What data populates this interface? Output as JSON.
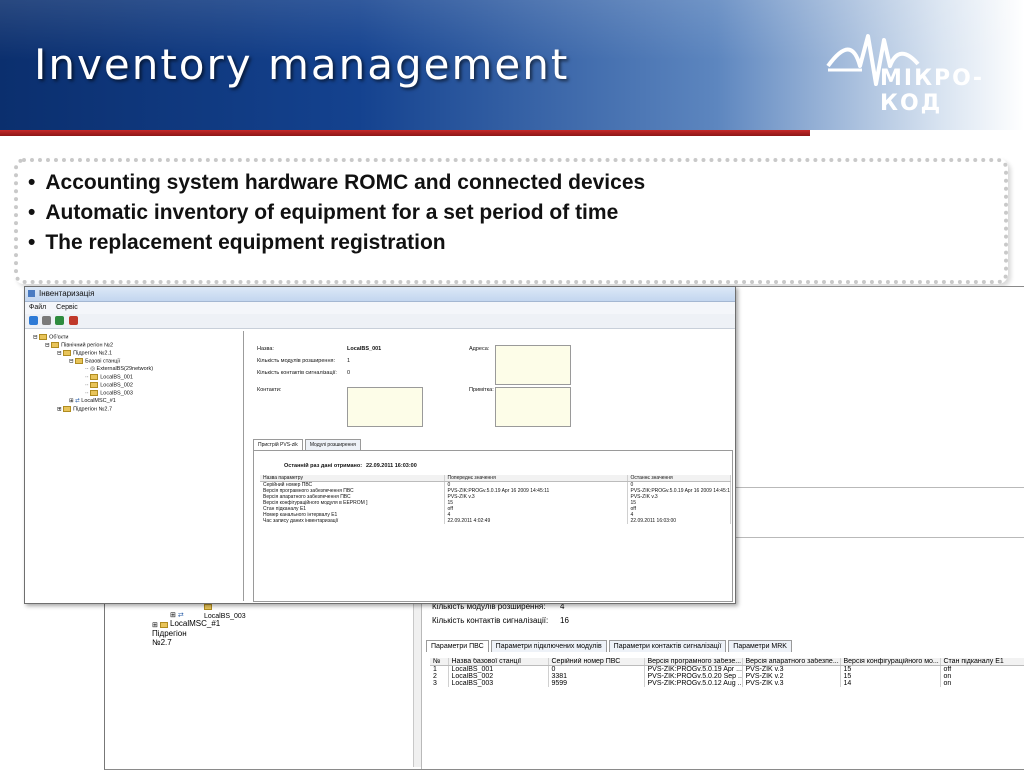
{
  "slide": {
    "title": "Inventory management",
    "logo_text": "МІКРО-КОД",
    "bullets": [
      "Accounting system hardware ROMC and connected devices",
      "Automatic inventory of equipment for a set period of time",
      "The replacement equipment registration"
    ]
  },
  "colors": {
    "header_dark": "#0b2f6e",
    "accent_red": "#c62a2a",
    "field_bg": "#fdfde8"
  },
  "front_window": {
    "title": "Інвентаризація",
    "menu": [
      "Файл",
      "Сервіс"
    ],
    "tree": [
      "Об'єкти",
      "Північний регіон №2",
      "Підрегіон №2.1",
      "Базові станції",
      "ExternalBS(29network)",
      "LocalBS_001",
      "LocalBS_002",
      "LocalBS_003",
      "LocalMSC_#1",
      "Підрегіон №2.7"
    ],
    "fields": {
      "name_label": "Назва:",
      "name_value": "LocalBS_001",
      "address_label": "Адреса:",
      "modules_label": "Кількість модулів розширення:",
      "modules_value": "1",
      "contacts_count_label": "Кількість контактів сигналізації:",
      "contacts_count_value": "0",
      "contacts_label": "Контакти:",
      "note_label": "Примітка:"
    },
    "tabs": [
      "Пристрій PVS-zik",
      "Модулі розширення"
    ],
    "last_data_label": "Останній раз дані отримано:",
    "last_data_value": "22.09.2011 16:03:00",
    "table": {
      "headers": [
        "Назва параметру",
        "Попереднє значення",
        "Останнє значення"
      ],
      "rows": [
        [
          "Серійний номер ПВС",
          "0",
          "0"
        ],
        [
          "Версія програмного забезпечення ПВС",
          "PVS-ZIK:PROGv.5.0.19 Apr 16 2009 14:45:11",
          "PVS-ZIK:PROGv.5.0.19 Apr 16 2009 14:45:11"
        ],
        [
          "Версія апаратного забезпечення ПВС",
          "PVS-ZIK v.3",
          "PVS-ZIK v.3"
        ],
        [
          "Версія конфігураційного модуля в EEPROM ]",
          "15",
          "15"
        ],
        [
          "Стан підканалу Е1",
          "off",
          "off"
        ],
        [
          "Номер канального інтервалу Е1",
          "4",
          "4"
        ],
        [
          "Час запису даних інвентаризації",
          "22.09.2011 4:02:49",
          "22.09.2011 16:03:00"
        ]
      ]
    }
  },
  "back_window": {
    "tree": [
      "LocalBS_003",
      "LocalMSC_#1",
      "Підрегіон №2.7"
    ],
    "fields": [
      {
        "label": "Кількість модулів розширення:",
        "value": "4"
      },
      {
        "label": "Кількість контактів сигналізації:",
        "value": "16"
      }
    ],
    "tabs": [
      "Параметри ПВС",
      "Параметри підключених модулів",
      "Параметри контактів сигналізації",
      "Параметри MRK"
    ],
    "table": {
      "headers": [
        "№",
        "Назва базової станції",
        "Серійний номер ПВС",
        "Версія програмного забезе...",
        "Версія апаратного забезпе...",
        "Версія конфігураційного мо...",
        "Стан підканалу Е1"
      ],
      "rows": [
        [
          "1",
          "LocalBS_001",
          "0",
          "PVS-ZIK:PROGv.5.0.19 Apr ...",
          "PVS-ZIK v.3",
          "15",
          "off"
        ],
        [
          "2",
          "LocalBS_002",
          "3381",
          "PVS-ZIK:PROGv.5.0.20 Sep ...",
          "PVS-ZIK v.2",
          "15",
          "on"
        ],
        [
          "3",
          "LocalBS_003",
          "9599",
          "PVS-ZIK:PROGv.5.0.12 Aug ...",
          "PVS-ZIK v.3",
          "14",
          "on"
        ]
      ]
    }
  }
}
